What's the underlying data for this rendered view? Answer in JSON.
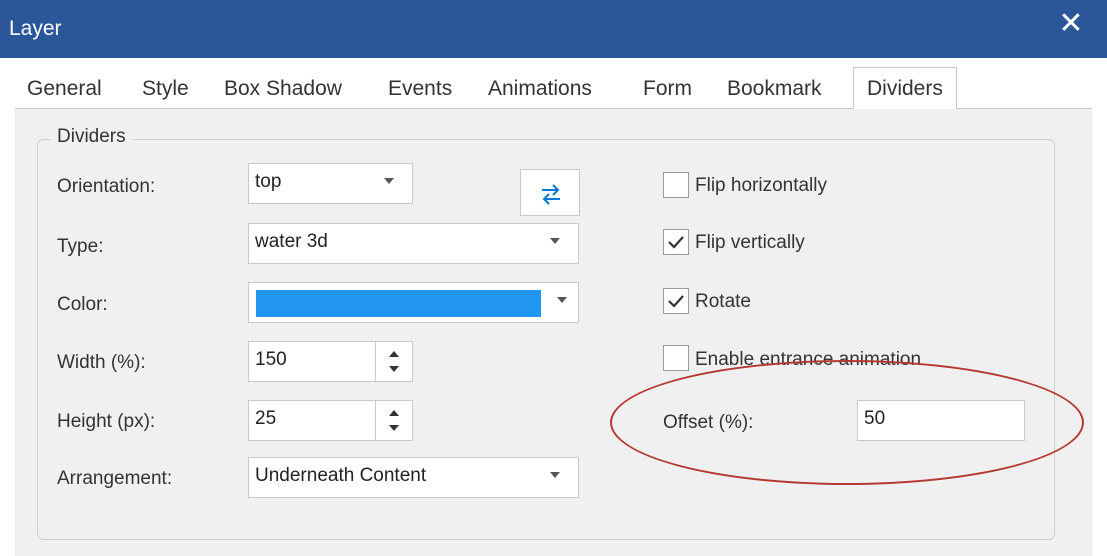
{
  "window": {
    "title": "Layer",
    "close_glyph": "✕"
  },
  "tabs": [
    {
      "label": "General",
      "active": false
    },
    {
      "label": "Style",
      "active": false
    },
    {
      "label": "Box Shadow",
      "active": false
    },
    {
      "label": "Events",
      "active": false
    },
    {
      "label": "Animations",
      "active": false
    },
    {
      "label": "Form",
      "active": false
    },
    {
      "label": "Bookmark",
      "active": false
    },
    {
      "label": "Dividers",
      "active": true
    }
  ],
  "group": {
    "title": "Dividers"
  },
  "form": {
    "orientation": {
      "label": "Orientation:",
      "value": "top"
    },
    "type": {
      "label": "Type:",
      "value": "water 3d"
    },
    "color": {
      "label": "Color:",
      "value": "#2196f3"
    },
    "width": {
      "label": "Width (%):",
      "value": "150"
    },
    "height": {
      "label": "Height (px):",
      "value": "25"
    },
    "arrangement": {
      "label": "Arrangement:",
      "value": "Underneath Content"
    },
    "offset": {
      "label": "Offset (%):",
      "value": "50"
    }
  },
  "swap_icon": "swap-arrows-icon",
  "checkboxes": [
    {
      "label": "Flip horizontally",
      "checked": false
    },
    {
      "label": "Flip vertically",
      "checked": true
    },
    {
      "label": "Rotate",
      "checked": true
    },
    {
      "label": "Enable entrance animation",
      "checked": false
    }
  ],
  "colors": {
    "titlebar": "#2b579a",
    "accent": "#0078d7",
    "annotation": "#b5382f"
  }
}
